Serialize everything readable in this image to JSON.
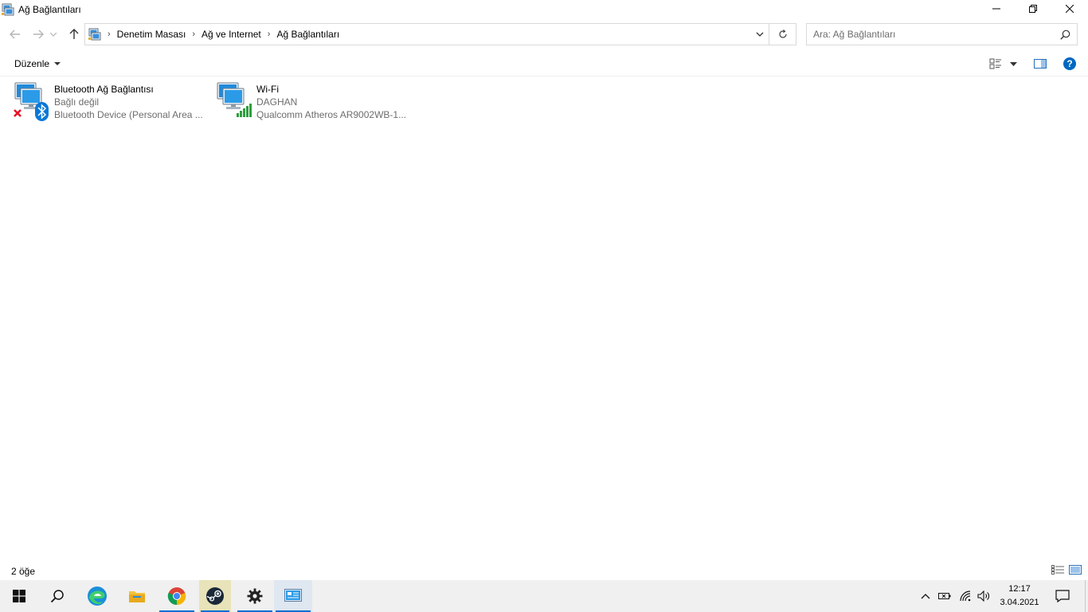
{
  "window": {
    "title": "Ağ Bağlantıları",
    "controls": {
      "minimize": "minimize-icon",
      "restore": "restore-icon",
      "close": "close-icon"
    }
  },
  "address": {
    "crumbs": [
      "Denetim Masası",
      "Ağ ve Internet",
      "Ağ Bağlantıları"
    ]
  },
  "search": {
    "placeholder": "Ara: Ağ Bağlantıları"
  },
  "toolbar": {
    "organize_label": "Düzenle"
  },
  "items": [
    {
      "name": "Bluetooth Ağ Bağlantısı",
      "status": "Bağlı değil",
      "device": "Bluetooth Device (Personal Area ...",
      "icon": "bluetooth-network-icon"
    },
    {
      "name": "Wi-Fi",
      "status": "DAGHAN",
      "device": "Qualcomm Atheros AR9002WB-1...",
      "icon": "wifi-network-icon"
    }
  ],
  "statusbar": {
    "count": "2 öğe"
  },
  "taskbar": {
    "apps": [
      "start",
      "search",
      "edge",
      "file-explorer",
      "chrome",
      "steam",
      "settings",
      "network-connections"
    ],
    "clock": {
      "time": "12:17",
      "date": "3.04.2021"
    }
  },
  "colors": {
    "accent": "#0a6ed1",
    "help": "#0067c0",
    "error": "#e81123",
    "signal": "#2e9e3e"
  }
}
